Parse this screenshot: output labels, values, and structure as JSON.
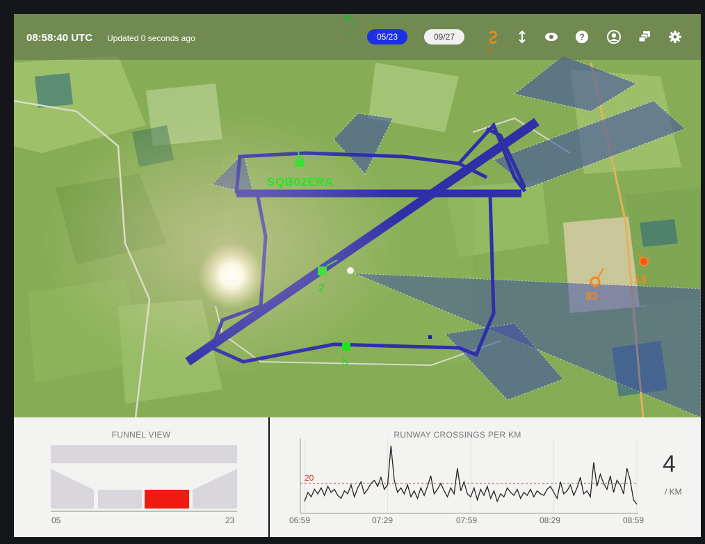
{
  "header": {
    "time": "08:58:40 UTC",
    "updated": "Updated 0 seconds ago",
    "runway_active": "05/23",
    "runway_inactive": "09/27",
    "icons": [
      "arrows-vertical-icon",
      "eye-icon",
      "help-icon",
      "user-icon",
      "layers-icon",
      "gear-icon"
    ]
  },
  "map": {
    "callsign": "SQB02ERA",
    "tags_green": [
      "1",
      "2",
      "5"
    ],
    "tags_orange": [
      "4",
      "83",
      "13"
    ]
  },
  "funnel": {
    "title": "FUNNEL VIEW",
    "left_label": "05",
    "right_label": "23",
    "active_color": "#ee1c10"
  },
  "crossings": {
    "title": "RUNWAY CROSSINGS PER KM",
    "value": "4",
    "unit": "/ KM",
    "threshold_label": "20",
    "x_labels": [
      "06:59",
      "07:29",
      "07:59",
      "08:29",
      "08:59"
    ]
  },
  "chart_data": {
    "type": "line",
    "title": "RUNWAY CROSSINGS PER KM",
    "x_ticks": [
      "06:59",
      "07:29",
      "07:59",
      "08:29",
      "08:59"
    ],
    "threshold": 20,
    "ylim": [
      0,
      50
    ],
    "series": [
      {
        "values": [
          8,
          14,
          11,
          16,
          13,
          17,
          12,
          18,
          14,
          16,
          12,
          10,
          15,
          13,
          19,
          11,
          17,
          21,
          13,
          16,
          20,
          22,
          18,
          24,
          16,
          19,
          45,
          22,
          14,
          17,
          13,
          19,
          11,
          15,
          10,
          17,
          12,
          18,
          25,
          13,
          16,
          20,
          15,
          11,
          17,
          13,
          30,
          15,
          21,
          13,
          11,
          17,
          9,
          16,
          12,
          18,
          10,
          15,
          8,
          13,
          11,
          17,
          14,
          12,
          16,
          10,
          14,
          12,
          16,
          11,
          15,
          13,
          12,
          16,
          18,
          14,
          10,
          21,
          13,
          15,
          19,
          12,
          17,
          24,
          13,
          15,
          11,
          34,
          18,
          26,
          20,
          16,
          25,
          14,
          22,
          19,
          13,
          30,
          22,
          9,
          6
        ]
      }
    ]
  }
}
